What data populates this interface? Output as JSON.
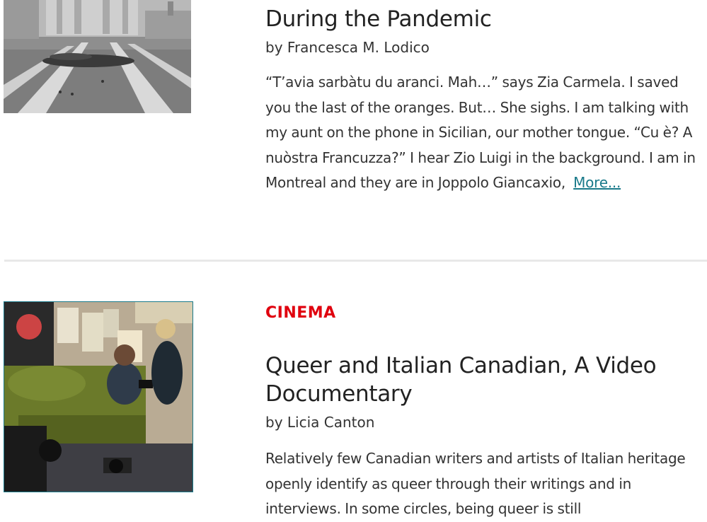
{
  "articles": [
    {
      "title_line1": "During the Pandemic",
      "byline": "by Francesca M. Lodico",
      "excerpt": "“T’avia sarbàtu du aranci. Mah…” says Zia Carmela. I saved you the last of the oranges. But… She sighs. I am talking with my aunt on the phone in Sicilian, our mother tongue. “Cu è? A nuòstra Francuzza?” I hear Zio Luigi in the background. I am in Montreal and they are in Joppolo Giancaxio,",
      "more_label": "More..."
    },
    {
      "category": "CINEMA",
      "title": "Queer and Italian Canadian, A Video Documentary",
      "byline": "by Licia Canton",
      "excerpt": "Relatively few Canadian writers and artists of Italian heritage openly identify as queer through their writings and in interviews. In some circles, being queer is still"
    }
  ],
  "colors": {
    "category": "#e0000e",
    "link": "#1a7a8a",
    "divider": "#e8e8e8"
  }
}
